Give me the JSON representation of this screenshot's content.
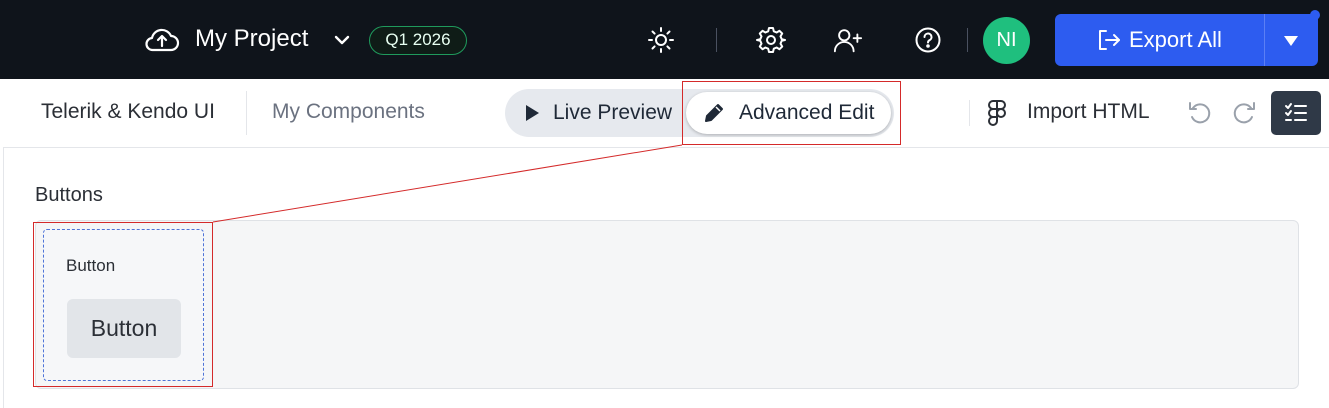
{
  "header": {
    "project_title": "My Project",
    "quarter_badge": "Q1 2026",
    "avatar_initials": "NI",
    "export_label": "Export All",
    "icons": [
      "cloud-upload-icon",
      "chevron-down-icon",
      "sun-icon",
      "gear-icon",
      "user-plus-icon",
      "help-icon",
      "export-icon",
      "caret-down-icon"
    ]
  },
  "toolbar": {
    "tabs": [
      {
        "label": "Telerik & Kendo UI"
      },
      {
        "label": "My Components"
      }
    ],
    "mode_live": "Live Preview",
    "mode_advanced": "Advanced Edit",
    "import_label": "Import HTML",
    "icons": [
      "play-icon",
      "pencil-icon",
      "figma-icon",
      "undo-icon",
      "redo-icon",
      "checklist-icon"
    ]
  },
  "content": {
    "section_title": "Buttons",
    "component": {
      "label": "Button",
      "button_text": "Button"
    }
  },
  "colors": {
    "topbar_bg": "#0f141b",
    "accent": "#2d5cf0",
    "avatar": "#1fbf7e",
    "badge_border": "#1f9a5c",
    "highlight": "#d42a2a"
  }
}
